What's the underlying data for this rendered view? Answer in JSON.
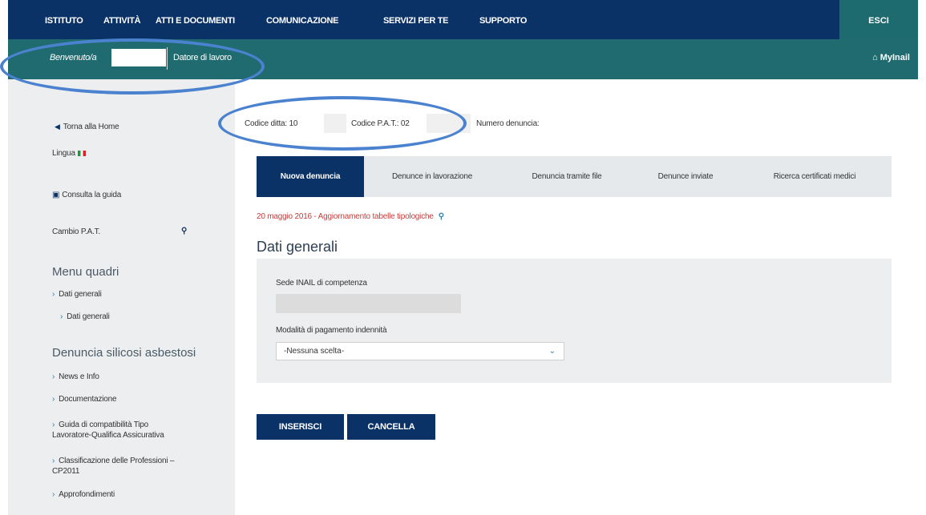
{
  "topnav": {
    "items": [
      "ISTITUTO",
      "ATTIVITÀ",
      "ATTI E DOCUMENTI",
      "COMUNICAZIONE",
      "SERVIZI PER TE",
      "SUPPORTO"
    ],
    "exit_label": "ESCI"
  },
  "welcome": {
    "greeting": "Benvenuto/a",
    "role": "Datore di lavoro",
    "mynail": "MyInail"
  },
  "sidebar": {
    "back_home": "Torna alla Home",
    "language_label": "Lingua",
    "guide_label": "Consulta la guida",
    "cambio_pat": "Cambio P.A.T.",
    "menu_quadri_title": "Menu quadri",
    "menu_quadri_items": [
      "Dati generali",
      "Dati generali"
    ],
    "section_title": "Denuncia silicosi asbestosi",
    "section_items": [
      "News e Info",
      "Documentazione",
      "Guida di compatibilità Tipo",
      "Lavoratore-Qualifica Assicurativa",
      "Classificazione delle Professioni –",
      "CP2011",
      "Approfondimenti"
    ]
  },
  "codes": {
    "codice_ditta": "Codice ditta: 10",
    "codice_pat": "Codice P.A.T.: 02",
    "numero_denuncia": "Numero denuncia:"
  },
  "tabs": [
    "Nuova denuncia",
    "Denunce in lavorazione",
    "Denuncia tramite file",
    "Denunce inviate",
    "Ricerca certificati medici"
  ],
  "update_notice": "20 maggio 2016 - Aggiornamento tabelle tipologiche",
  "form": {
    "title": "Dati generali",
    "sede_label": "Sede INAIL di competenza",
    "sede_value": "",
    "pagamento_label": "Modalità di pagamento indennità",
    "pagamento_value": "-Nessuna scelta-"
  },
  "buttons": {
    "insert": "INSERISCI",
    "cancel": "CANCELLA"
  },
  "colors": {
    "nav_blue": "#0b3267",
    "teal": "#1f6b70",
    "highlight_oval": "#4a82cf",
    "update_red": "#c43d3d"
  },
  "icons": [
    "back-arrow-icon",
    "italian-flag-icon",
    "book-icon",
    "search-icon",
    "chevron-right-icon",
    "home-icon",
    "dropdown-caret-icon"
  ]
}
